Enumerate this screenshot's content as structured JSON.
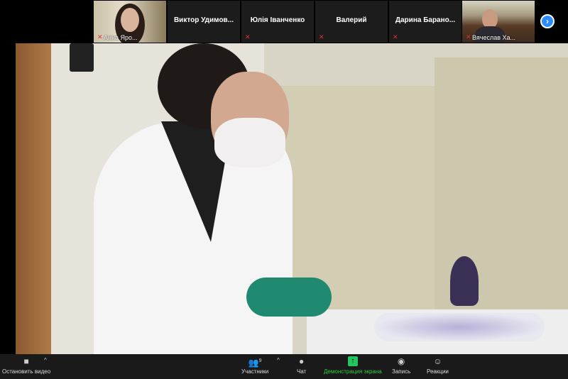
{
  "participants_strip": [
    {
      "name": "Анна Яро...",
      "has_video": true,
      "muted": true,
      "pinned": true
    },
    {
      "name": "Виктор  Удимов...",
      "has_video": false,
      "muted": false
    },
    {
      "name": "Юлія Іванченко",
      "has_video": false,
      "muted": true
    },
    {
      "name": "Валерий",
      "has_video": false,
      "muted": true
    },
    {
      "name": "Дарина  Барано...",
      "has_video": false,
      "muted": true
    },
    {
      "name": "Вячеслав Ха...",
      "has_video": true,
      "muted": true
    }
  ],
  "toolbar": {
    "stop_video": "Остановить видео",
    "participants": "Участники",
    "participants_count": "9",
    "chat": "Чат",
    "share_screen": "Демонстрация экрана",
    "record": "Запись",
    "reactions": "Реакции"
  },
  "colors": {
    "accent": "#2d8cff",
    "share": "#22c55e",
    "muted": "#e03030"
  }
}
